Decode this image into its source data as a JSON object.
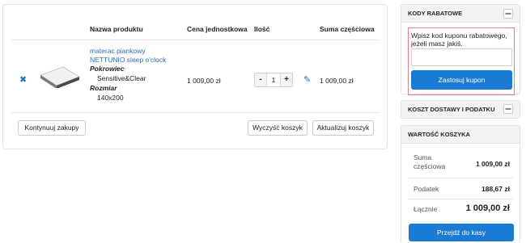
{
  "cart": {
    "headers": {
      "product": "Nazwa produktu",
      "unit_price": "Cena jednostkowa",
      "quantity": "Ilość",
      "subtotal": "Suma częściowa"
    },
    "item": {
      "name": "materac piankowy NETTUNIO sleep o'clock",
      "option1_label": "Pokrowiec",
      "option1_value": "Sensitive&Clear",
      "option2_label": "Rozmiar",
      "option2_value": "140x200",
      "unit_price": "1 009,00 zł",
      "quantity": "1",
      "subtotal": "1 009,00 zł"
    },
    "qty_minus": "-",
    "qty_plus": "+",
    "continue_label": "Kontynuuj zakupy",
    "clear_label": "Wyczyść koszyk",
    "update_label": "Aktualizuj koszyk"
  },
  "coupon": {
    "title": "KODY RABATOWE",
    "text": "Wpisz kod kuponu rabatowego, jeżeli masz jakiś.",
    "apply_label": "Zastosuj kupon"
  },
  "shipping": {
    "title": "KOSZT DOSTAWY I PODATKU"
  },
  "totals": {
    "title": "WARTOŚĆ KOSZYKA",
    "subtotal_label": "Suma częściowa",
    "subtotal_value": "1 009,00 zł",
    "tax_label": "Podatek",
    "tax_value": "188,67 zł",
    "total_label": "Łącznie",
    "total_value": "1 009,00 zł",
    "checkout_label": "Przejdź do kasy"
  },
  "colors": {
    "accent": "#1a7bd4",
    "link": "#2a6fb2",
    "highlight_border": "#e08080"
  }
}
